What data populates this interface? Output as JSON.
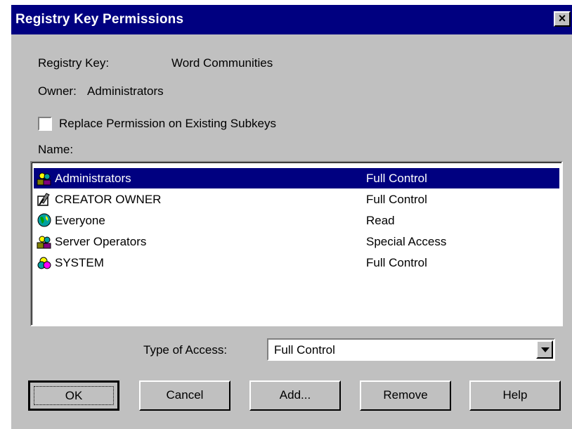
{
  "window": {
    "title": "Registry Key Permissions",
    "close_label": "×"
  },
  "info": {
    "registry_key_label": "Registry Key:",
    "registry_key_value": "Word Communities",
    "owner_label": "Owner:",
    "owner_value": "Administrators"
  },
  "replace_checkbox": {
    "label": "Replace Permission on Existing Subkeys",
    "checked": false
  },
  "name_label": "Name:",
  "permissions": [
    {
      "name": "Administrators",
      "access": "Full Control",
      "icon": "group-icon",
      "selected": true
    },
    {
      "name": "CREATOR OWNER",
      "access": "Full Control",
      "icon": "creator-owner-icon",
      "selected": false
    },
    {
      "name": "Everyone",
      "access": "Read",
      "icon": "globe-icon",
      "selected": false
    },
    {
      "name": "Server Operators",
      "access": "Special Access",
      "icon": "group-icon",
      "selected": false
    },
    {
      "name": "SYSTEM",
      "access": "Full Control",
      "icon": "system-icon",
      "selected": false
    }
  ],
  "type_of_access": {
    "label": "Type of Access:",
    "value": "Full Control"
  },
  "buttons": {
    "ok": "OK",
    "cancel": "Cancel",
    "add": "Add...",
    "remove": "Remove",
    "help": "Help"
  },
  "colors": {
    "title_bar": "#000080",
    "dialog_face": "#c0c0c0",
    "selection": "#000080"
  }
}
